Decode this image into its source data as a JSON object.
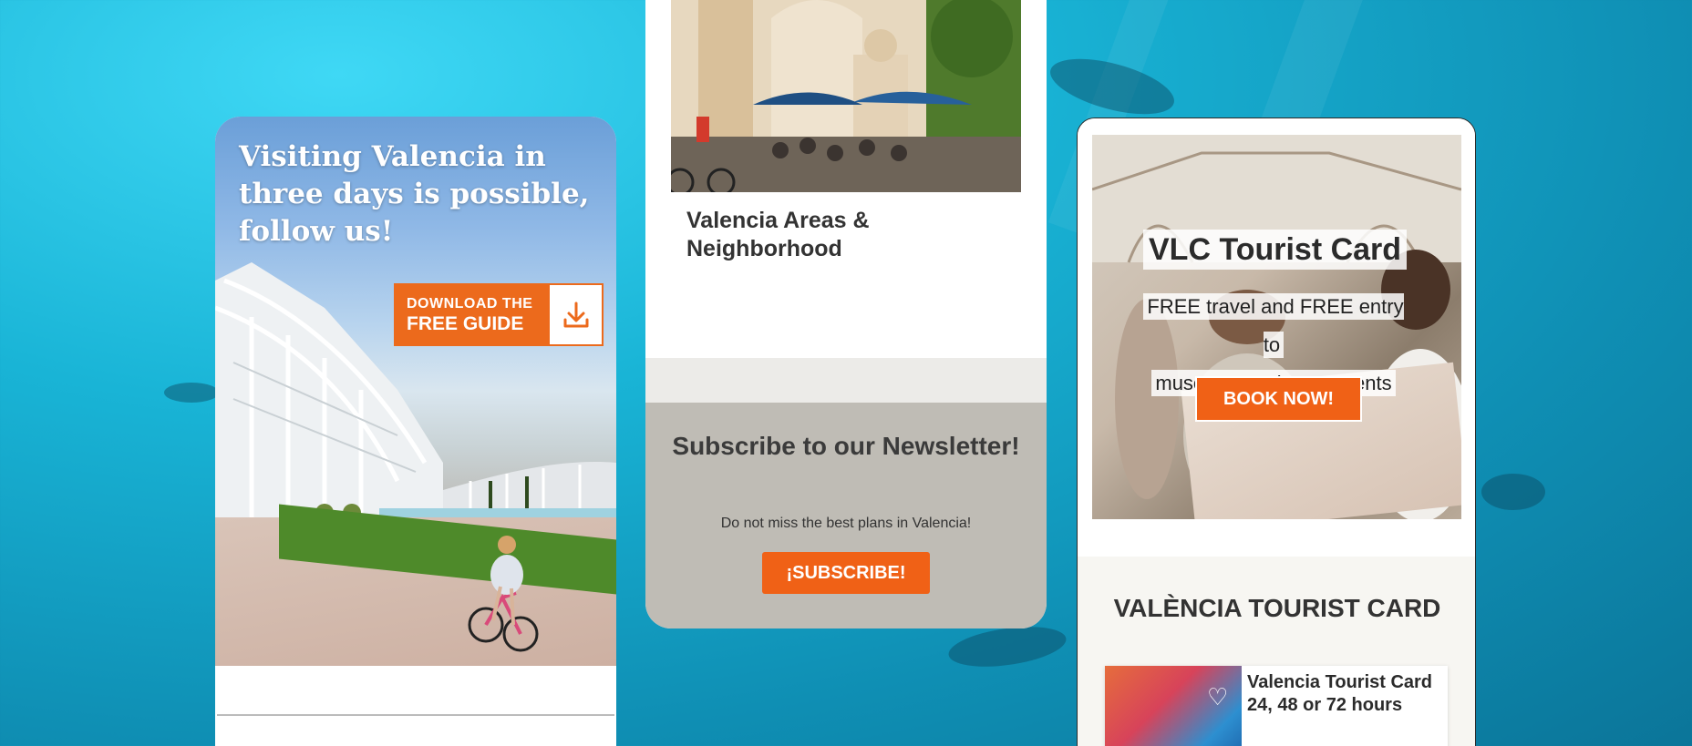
{
  "card_left": {
    "hero_title": "Visiting Valencia in three days is possible, follow us!",
    "download_button": {
      "line1": "DOWNLOAD THE",
      "line2": "FREE GUIDE",
      "icon": "download-icon"
    }
  },
  "card_middle": {
    "area_title": "Valencia Areas & Neighborhood",
    "newsletter": {
      "title": "Subscribe to our Newsletter!",
      "subtitle": "Do not miss the best plans in Valencia!",
      "button": "¡SUBSCRIBE!"
    }
  },
  "card_right": {
    "promo": {
      "title": "VLC Tourist Card",
      "subtitle_line1": "FREE travel and FREE entry to",
      "subtitle_line2": "museums and monuments",
      "button": "BOOK NOW!"
    },
    "section_title": "VALÈNCIA TOURIST CARD",
    "product": {
      "title": "Valencia Tourist Card 24, 48 or 72 hours",
      "icon": "heart-icon"
    }
  },
  "colors": {
    "accent_orange": "#f06116",
    "newsletter_bg": "#bfbcb5",
    "ocean": "#19b4d6"
  }
}
